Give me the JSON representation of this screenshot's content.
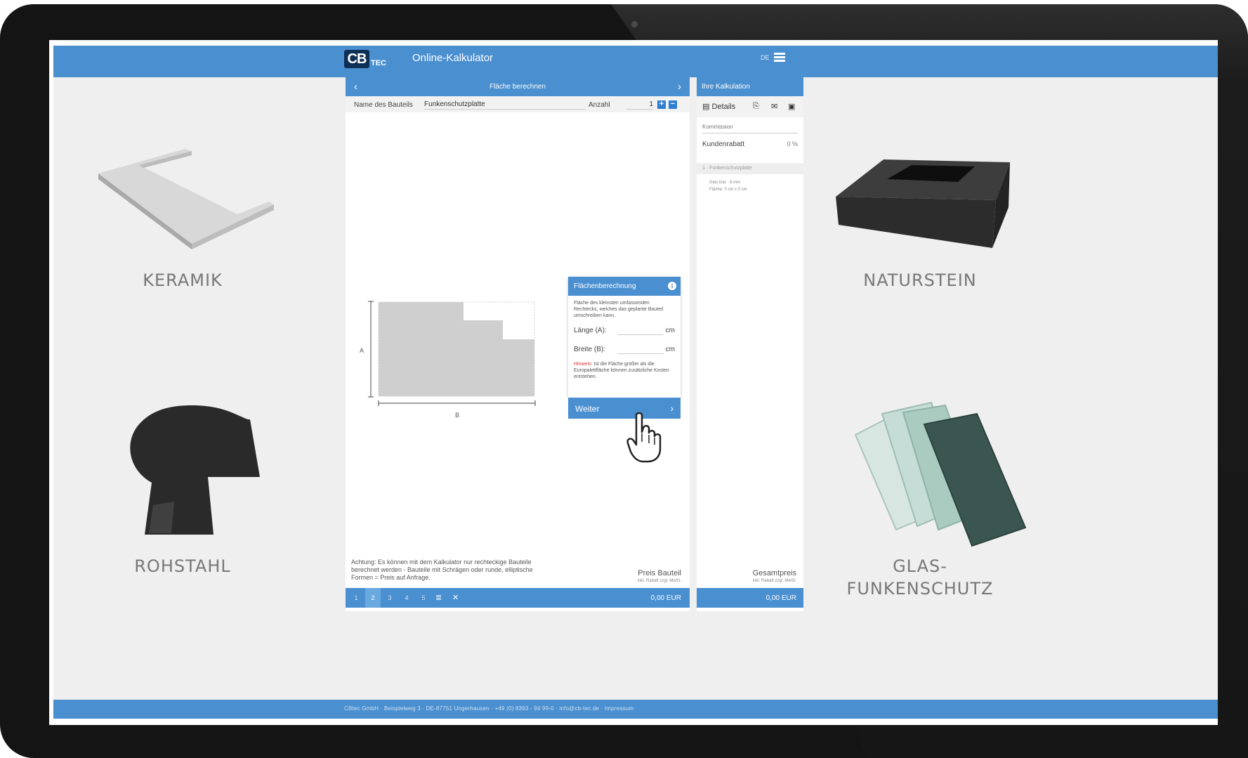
{
  "header": {
    "logo_main": "CB",
    "logo_sub": "TEC",
    "title": "Online-Kalkulator",
    "language": "DE"
  },
  "products": {
    "keramik": "KERAMIK",
    "naturstein": "NATURSTEIN",
    "rohstahl": "ROHSTAHL",
    "glas_line1": "GLAS-",
    "glas_line2": "FUNKENSCHUTZ"
  },
  "calculator": {
    "header_title": "Fläche berechnen",
    "name_label": "Name des Bauteils",
    "name_value": "Funkenschutzplatte",
    "count_label": "Anzahl",
    "count_value": "1",
    "dim_a": "A",
    "dim_b": "B",
    "area_box": {
      "title": "Flächenberechnung",
      "description": "Fläche des kleinsten umfassenden Rechtecks, welches das geplante Bauteil umschreiben kann.",
      "length_label": "Länge (A):",
      "length_unit": "cm",
      "width_label": "Breite (B):",
      "width_unit": "cm",
      "hint_label": "Hinweis:",
      "hint_text": "Ist die Fläche größer als die Europalettfläche können zusätzliche Kosten entstehen.",
      "next_label": "Weiter"
    },
    "note": "Achtung: Es können mit dem Kalkulator nur rechteckige Bauteile berechnet werden - Bauteile mit Schrägen oder runde, elliptische Formen = Preis auf Anfrage.",
    "price_label": "Preis Bauteil",
    "price_sub": "inkl. Rabatt zzgl. MwSt.",
    "steps": [
      "1",
      "2",
      "3",
      "4",
      "5"
    ],
    "active_step": 2,
    "total": "0,00 EUR"
  },
  "sidebar": {
    "title": "Ihre Kalkulation",
    "details_label": "Details",
    "commission_placeholder": "Kommission",
    "discount_label": "Kundenrabatt",
    "discount_value": "0 %",
    "item_title": "1 · Funkenschutzplatte",
    "item_line1": "Glas klar · 8 mm",
    "item_line2": "Fläche: 0 cm x 0 cm",
    "total_label": "Gesamtpreis",
    "total_sub": "inkl. Rabatt zzgl. MwSt.",
    "total": "0,00 EUR"
  },
  "footer": {
    "text": "CBtec GmbH · Beispielweg 3 · DE-87751 Ungerhausen · +49 (0) 8393 - 94 99-0 · info@cb-tec.de · Impressum"
  },
  "colors": {
    "accent": "#4a8fd0",
    "background": "#efefef",
    "bezel": "#141414"
  }
}
